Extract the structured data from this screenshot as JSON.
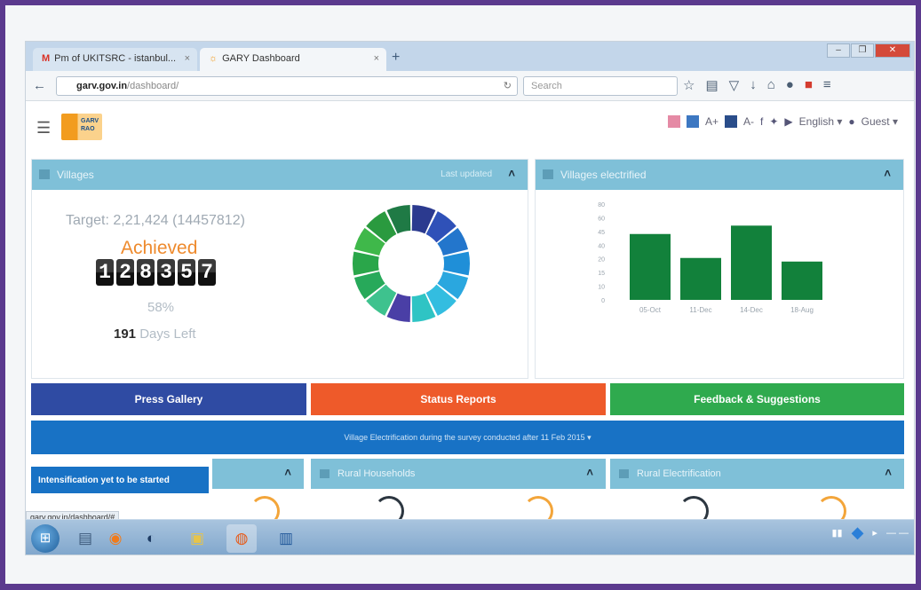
{
  "browser": {
    "tabs": [
      {
        "icon": "M",
        "icon_color": "#d93025",
        "label": "Pm of UKITSRC - istanbul..."
      },
      {
        "icon": "☼",
        "icon_color": "#f29c1f",
        "label": "GARY Dashboard"
      }
    ],
    "new_tab": "+",
    "url_host": "garv.gov.in",
    "url_path": "/dashboard/",
    "search_placeholder": "Search",
    "window_controls": [
      "–",
      "❐",
      "✕"
    ]
  },
  "header": {
    "menu_icon": "☰",
    "logo_text": "GARV\nRAO",
    "font_small": "A+",
    "font_large": "A-",
    "language": "English ▾",
    "user": "Guest ▾"
  },
  "electrification_panel": {
    "title": "Villages",
    "subtitle": "Last updated",
    "target_text": "Target: 2,21,424 (14457812)",
    "achieved_label": "Achieved",
    "achieved_digits": [
      "1",
      "2",
      "8",
      "3",
      "5",
      "7"
    ],
    "percent": "58%",
    "days_value": "191",
    "days_label": " Days Left",
    "donut_segments": [
      {
        "color": "#2b3a8f",
        "value": 1
      },
      {
        "color": "#2f51b8",
        "value": 1
      },
      {
        "color": "#2376cc",
        "value": 1
      },
      {
        "color": "#1f8fd8",
        "value": 1
      },
      {
        "color": "#2aa7df",
        "value": 1
      },
      {
        "color": "#33bde0",
        "value": 1
      },
      {
        "color": "#2fc4c4",
        "value": 1
      },
      {
        "color": "#4a3fa6",
        "value": 1
      },
      {
        "color": "#3ec28e",
        "value": 1
      },
      {
        "color": "#27a95a",
        "value": 1
      },
      {
        "color": "#2aa64a",
        "value": 1
      },
      {
        "color": "#3fb84a",
        "value": 1
      },
      {
        "color": "#2a9a3f",
        "value": 1
      },
      {
        "color": "#1f7a45",
        "value": 1
      }
    ]
  },
  "bar_panel": {
    "title": "Villages electrified",
    "chart_data": {
      "type": "bar",
      "categories": [
        "05-Oct",
        "11-Dec",
        "14-Dec",
        "18-Aug"
      ],
      "values": [
        55,
        35,
        62,
        32
      ],
      "ylim": [
        0,
        80
      ],
      "yticks": [
        "80",
        "60",
        "45",
        "40",
        "20",
        "15",
        "10",
        "0"
      ],
      "bar_color": "#12813b",
      "grid": false
    }
  },
  "actions": {
    "press_gallery": "Press Gallery",
    "status_reports": "Status Reports",
    "feedback": "Feedback & Suggestions",
    "banner": "Village Electrification during the survey conducted after 11 Feb 2015 ▾"
  },
  "lower": {
    "side_label": "Intensification yet to be started",
    "panels": [
      {
        "title": ""
      },
      {
        "title": "Rural Households"
      },
      {
        "title": "Rural Electrification"
      }
    ],
    "status_url": "garv.gov.in/dashboard/#"
  },
  "taskbar": {
    "items": [
      "⊞",
      "▤",
      "◉",
      "◐",
      "▣",
      "◍",
      "▥"
    ],
    "tray": [
      "▮▮",
      "◆",
      "▸",
      "— —"
    ]
  }
}
